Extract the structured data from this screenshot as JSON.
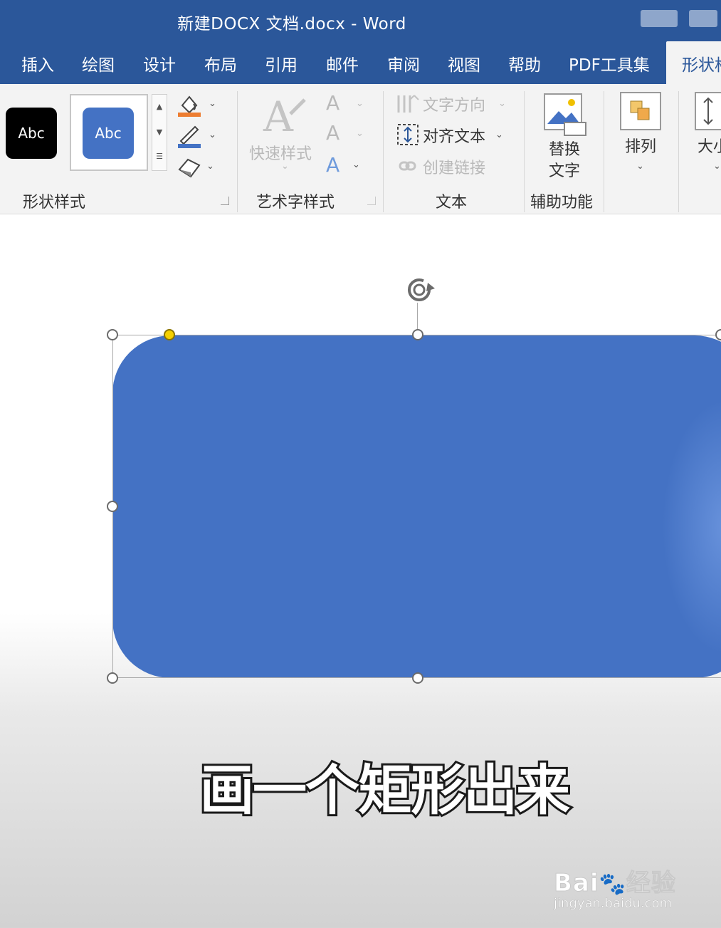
{
  "window": {
    "title": "新建DOCX 文档.docx  -  Word"
  },
  "tabs": [
    {
      "label": "插入"
    },
    {
      "label": "绘图"
    },
    {
      "label": "设计"
    },
    {
      "label": "布局"
    },
    {
      "label": "引用"
    },
    {
      "label": "邮件"
    },
    {
      "label": "审阅"
    },
    {
      "label": "视图"
    },
    {
      "label": "帮助"
    },
    {
      "label": "PDF工具集"
    },
    {
      "label": "形状格式",
      "active": true
    }
  ],
  "ribbon": {
    "shape_styles": {
      "label": "形状样式",
      "swatches": [
        {
          "label": "Abc",
          "color": "#000000"
        },
        {
          "label": "Abc",
          "color": "#4472c4"
        }
      ]
    },
    "wordart_styles": {
      "label": "艺术字样式",
      "quick_styles_label": "快速样式"
    },
    "text": {
      "label": "文本",
      "text_direction_label": "文字方向",
      "align_text_label": "对齐文本",
      "create_link_label": "创建链接"
    },
    "accessibility": {
      "label": "辅助功能",
      "alt_text_line1": "替换",
      "alt_text_line2": "文字"
    },
    "arrange": {
      "label": "排列"
    },
    "size": {
      "label": "大小"
    }
  },
  "shape": {
    "fill": "#4472c4"
  },
  "caption": {
    "text": "画一个矩形出来"
  },
  "watermark": {
    "logo": "Bai",
    "logo_suffix": "经验",
    "url": "jingyan.baidu.com"
  }
}
